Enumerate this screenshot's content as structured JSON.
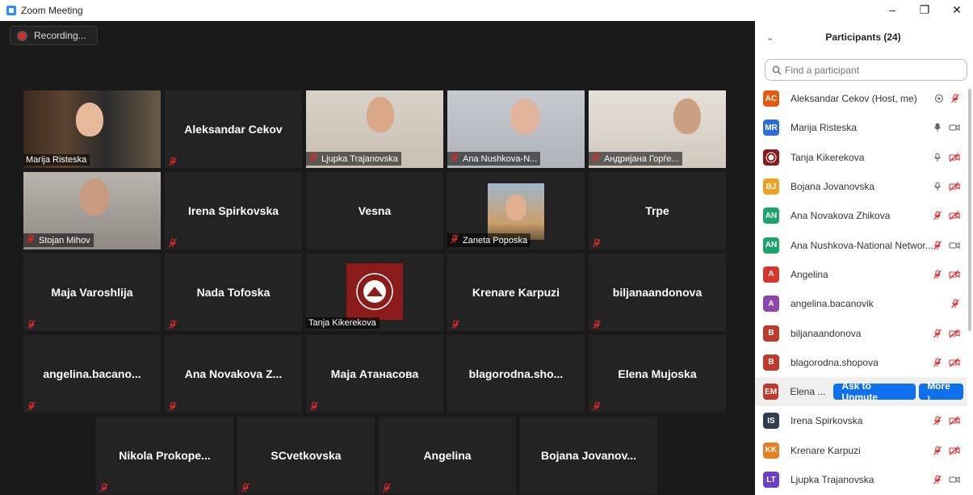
{
  "window": {
    "title": "Zoom Meeting",
    "min": "–",
    "max": "❐",
    "close": "✕"
  },
  "recording": {
    "label": "Recording..."
  },
  "tiles": [
    {
      "label": "Marija Risteska",
      "video": true,
      "active": true,
      "muted": false
    },
    {
      "name": "Aleksandar Cekov",
      "video": false,
      "muted": true
    },
    {
      "label": "Ljupka Trajanovska",
      "video": true,
      "muted": true
    },
    {
      "label": "Ana Nushkova-N...",
      "video": true,
      "muted": true
    },
    {
      "label": "Андријана Горѓе...",
      "video": true,
      "muted": true
    },
    {
      "label": "Stojan Mihov",
      "video": true,
      "muted": true
    },
    {
      "name": "Irena Spirkovska",
      "video": false,
      "muted": true
    },
    {
      "name": "Vesna",
      "video": false,
      "muted": false
    },
    {
      "label": "Zaneta Poposka",
      "video": true,
      "muted": true
    },
    {
      "name": "Trpe",
      "video": false,
      "muted": true
    },
    {
      "name": "Maja Varoshlija",
      "video": false,
      "muted": true
    },
    {
      "name": "Nada Tofoska",
      "video": false,
      "muted": true
    },
    {
      "label": "Tanja Kikerekova",
      "video": true,
      "muted": false
    },
    {
      "name": "Krenare Karpuzi",
      "video": false,
      "muted": true
    },
    {
      "name": "biljanaandonova",
      "video": false,
      "muted": true
    },
    {
      "name": "angelina.bacano...",
      "video": false,
      "muted": true
    },
    {
      "name": "Ana Novakova Z...",
      "video": false,
      "muted": true
    },
    {
      "name": "Маја Атанасова",
      "video": false,
      "muted": true
    },
    {
      "name": "blagorodna.sho...",
      "video": false,
      "muted": false
    },
    {
      "name": "Elena Mujoska",
      "video": false,
      "muted": true
    },
    {
      "name": "Nikola Prokope...",
      "video": false,
      "muted": true
    },
    {
      "name": "SCvetkovska",
      "video": false,
      "muted": true
    },
    {
      "name": "Angelina",
      "video": false,
      "muted": true
    },
    {
      "name": "Bojana Jovanov...",
      "video": false,
      "muted": false
    }
  ],
  "panel": {
    "title": "Participants (24)",
    "search_placeholder": "Find a participant",
    "ask_to_unmute": "Ask to Unmute",
    "more": "More ›",
    "participants": [
      {
        "initials": "AC",
        "name": "Aleksandar Cekov (Host, me)",
        "color": "#e8590c",
        "icons": [
          "share",
          "mic-off"
        ]
      },
      {
        "initials": "MR",
        "name": "Marija Risteska",
        "color": "#2d6cdf",
        "icons": [
          "mic-on",
          "cam-on"
        ]
      },
      {
        "initials": "",
        "name": "Tanja Kikerekova",
        "color": "#8b1a1a",
        "icons": [
          "mic-idle",
          "cam-off"
        ],
        "emblem": true
      },
      {
        "initials": "BJ",
        "name": "Bojana Jovanovska",
        "color": "#f0a020",
        "icons": [
          "mic-idle",
          "cam-off"
        ]
      },
      {
        "initials": "AN",
        "name": "Ana Novakova Zhikova",
        "color": "#1aa36b",
        "icons": [
          "mic-off",
          "cam-off"
        ]
      },
      {
        "initials": "AN",
        "name": "Ana Nushkova-National Networ...",
        "color": "#1aa36b",
        "icons": [
          "mic-off",
          "cam-on"
        ]
      },
      {
        "initials": "A",
        "name": "Angelina",
        "color": "#d6362b",
        "icons": [
          "mic-off",
          "cam-off"
        ]
      },
      {
        "initials": "A",
        "name": "angelina.bacanovik",
        "color": "#8e44ad",
        "icons": [
          "mic-off"
        ]
      },
      {
        "initials": "B",
        "name": "biljanaandonova",
        "color": "#c0392b",
        "icons": [
          "mic-off",
          "cam-off"
        ]
      },
      {
        "initials": "B",
        "name": "blagorodna.shopova",
        "color": "#c0392b",
        "icons": [
          "mic-off",
          "cam-off"
        ]
      },
      {
        "initials": "EM",
        "name": "Elena ...",
        "color": "#c0392b",
        "icons": [],
        "hover": true
      },
      {
        "initials": "IS",
        "name": "Irena Spirkovska",
        "color": "#2c3e50",
        "icons": [
          "mic-off",
          "cam-off"
        ]
      },
      {
        "initials": "KK",
        "name": "Krenare Karpuzi",
        "color": "#e67e22",
        "icons": [
          "mic-off",
          "cam-off"
        ]
      },
      {
        "initials": "LT",
        "name": "Ljupka Trajanovska",
        "color": "#6c3fc7",
        "icons": [
          "mic-off",
          "cam-on"
        ]
      }
    ]
  }
}
